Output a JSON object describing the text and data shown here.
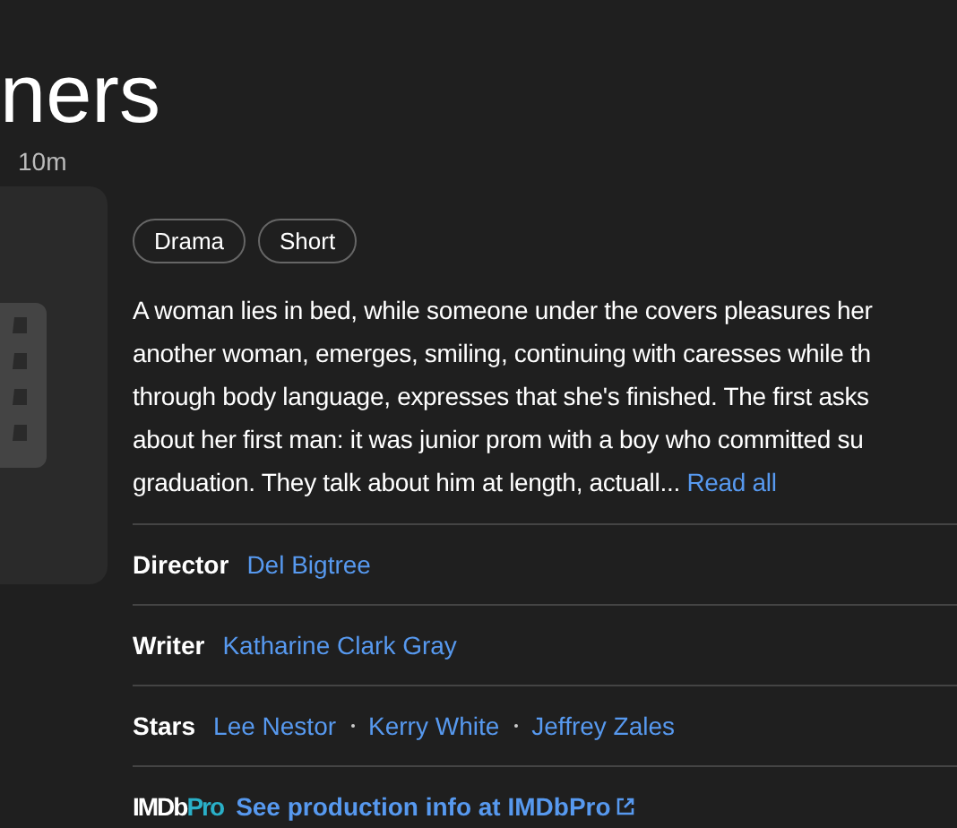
{
  "title": "ners",
  "runtime": "10m",
  "genres": [
    "Drama",
    "Short"
  ],
  "plot": {
    "text": "A woman lies in bed, while someone under the covers pleasures her\nanother woman, emerges, smiling, continuing with caresses while th\nthrough body language, expresses that she's finished. The first asks\nabout her first man: it was junior prom with a boy who committed su\ngraduation. They talk about him at length, actuall...",
    "link": "Read all"
  },
  "credits": [
    {
      "role": "Director",
      "names": [
        "Del Bigtree"
      ]
    },
    {
      "role": "Writer",
      "names": [
        "Katharine Clark Gray"
      ]
    },
    {
      "role": "Stars",
      "names": [
        "Lee Nestor",
        "Kerry White",
        "Jeffrey Zales"
      ]
    }
  ],
  "pro": {
    "logo_main": "IMDb",
    "logo_accent": "Pro",
    "link": "See production info at IMDbPro"
  }
}
